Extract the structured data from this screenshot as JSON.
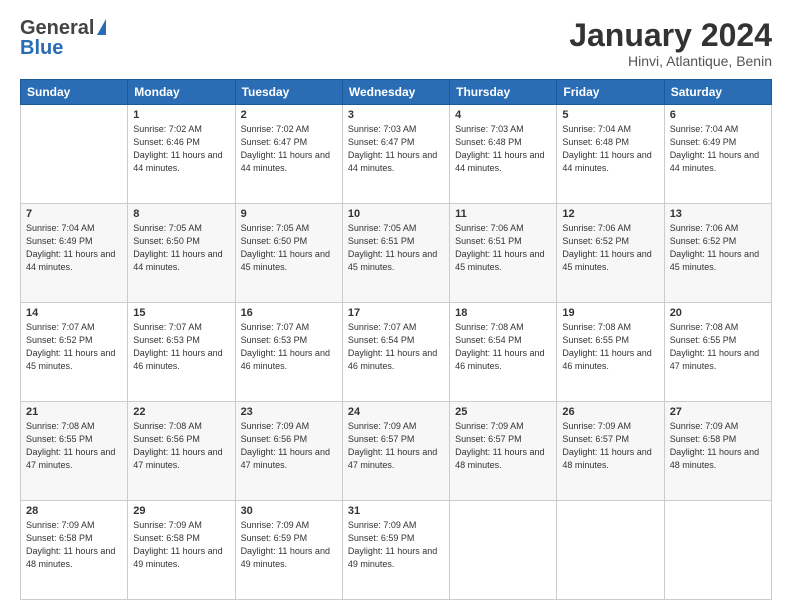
{
  "header": {
    "logo_general": "General",
    "logo_blue": "Blue",
    "title": "January 2024",
    "location": "Hinvi, Atlantique, Benin"
  },
  "days_of_week": [
    "Sunday",
    "Monday",
    "Tuesday",
    "Wednesday",
    "Thursday",
    "Friday",
    "Saturday"
  ],
  "weeks": [
    [
      {
        "day": "",
        "sunrise": "",
        "sunset": "",
        "daylight": ""
      },
      {
        "day": "1",
        "sunrise": "Sunrise: 7:02 AM",
        "sunset": "Sunset: 6:46 PM",
        "daylight": "Daylight: 11 hours and 44 minutes."
      },
      {
        "day": "2",
        "sunrise": "Sunrise: 7:02 AM",
        "sunset": "Sunset: 6:47 PM",
        "daylight": "Daylight: 11 hours and 44 minutes."
      },
      {
        "day": "3",
        "sunrise": "Sunrise: 7:03 AM",
        "sunset": "Sunset: 6:47 PM",
        "daylight": "Daylight: 11 hours and 44 minutes."
      },
      {
        "day": "4",
        "sunrise": "Sunrise: 7:03 AM",
        "sunset": "Sunset: 6:48 PM",
        "daylight": "Daylight: 11 hours and 44 minutes."
      },
      {
        "day": "5",
        "sunrise": "Sunrise: 7:04 AM",
        "sunset": "Sunset: 6:48 PM",
        "daylight": "Daylight: 11 hours and 44 minutes."
      },
      {
        "day": "6",
        "sunrise": "Sunrise: 7:04 AM",
        "sunset": "Sunset: 6:49 PM",
        "daylight": "Daylight: 11 hours and 44 minutes."
      }
    ],
    [
      {
        "day": "7",
        "sunrise": "Sunrise: 7:04 AM",
        "sunset": "Sunset: 6:49 PM",
        "daylight": "Daylight: 11 hours and 44 minutes."
      },
      {
        "day": "8",
        "sunrise": "Sunrise: 7:05 AM",
        "sunset": "Sunset: 6:50 PM",
        "daylight": "Daylight: 11 hours and 44 minutes."
      },
      {
        "day": "9",
        "sunrise": "Sunrise: 7:05 AM",
        "sunset": "Sunset: 6:50 PM",
        "daylight": "Daylight: 11 hours and 45 minutes."
      },
      {
        "day": "10",
        "sunrise": "Sunrise: 7:05 AM",
        "sunset": "Sunset: 6:51 PM",
        "daylight": "Daylight: 11 hours and 45 minutes."
      },
      {
        "day": "11",
        "sunrise": "Sunrise: 7:06 AM",
        "sunset": "Sunset: 6:51 PM",
        "daylight": "Daylight: 11 hours and 45 minutes."
      },
      {
        "day": "12",
        "sunrise": "Sunrise: 7:06 AM",
        "sunset": "Sunset: 6:52 PM",
        "daylight": "Daylight: 11 hours and 45 minutes."
      },
      {
        "day": "13",
        "sunrise": "Sunrise: 7:06 AM",
        "sunset": "Sunset: 6:52 PM",
        "daylight": "Daylight: 11 hours and 45 minutes."
      }
    ],
    [
      {
        "day": "14",
        "sunrise": "Sunrise: 7:07 AM",
        "sunset": "Sunset: 6:52 PM",
        "daylight": "Daylight: 11 hours and 45 minutes."
      },
      {
        "day": "15",
        "sunrise": "Sunrise: 7:07 AM",
        "sunset": "Sunset: 6:53 PM",
        "daylight": "Daylight: 11 hours and 46 minutes."
      },
      {
        "day": "16",
        "sunrise": "Sunrise: 7:07 AM",
        "sunset": "Sunset: 6:53 PM",
        "daylight": "Daylight: 11 hours and 46 minutes."
      },
      {
        "day": "17",
        "sunrise": "Sunrise: 7:07 AM",
        "sunset": "Sunset: 6:54 PM",
        "daylight": "Daylight: 11 hours and 46 minutes."
      },
      {
        "day": "18",
        "sunrise": "Sunrise: 7:08 AM",
        "sunset": "Sunset: 6:54 PM",
        "daylight": "Daylight: 11 hours and 46 minutes."
      },
      {
        "day": "19",
        "sunrise": "Sunrise: 7:08 AM",
        "sunset": "Sunset: 6:55 PM",
        "daylight": "Daylight: 11 hours and 46 minutes."
      },
      {
        "day": "20",
        "sunrise": "Sunrise: 7:08 AM",
        "sunset": "Sunset: 6:55 PM",
        "daylight": "Daylight: 11 hours and 47 minutes."
      }
    ],
    [
      {
        "day": "21",
        "sunrise": "Sunrise: 7:08 AM",
        "sunset": "Sunset: 6:55 PM",
        "daylight": "Daylight: 11 hours and 47 minutes."
      },
      {
        "day": "22",
        "sunrise": "Sunrise: 7:08 AM",
        "sunset": "Sunset: 6:56 PM",
        "daylight": "Daylight: 11 hours and 47 minutes."
      },
      {
        "day": "23",
        "sunrise": "Sunrise: 7:09 AM",
        "sunset": "Sunset: 6:56 PM",
        "daylight": "Daylight: 11 hours and 47 minutes."
      },
      {
        "day": "24",
        "sunrise": "Sunrise: 7:09 AM",
        "sunset": "Sunset: 6:57 PM",
        "daylight": "Daylight: 11 hours and 47 minutes."
      },
      {
        "day": "25",
        "sunrise": "Sunrise: 7:09 AM",
        "sunset": "Sunset: 6:57 PM",
        "daylight": "Daylight: 11 hours and 48 minutes."
      },
      {
        "day": "26",
        "sunrise": "Sunrise: 7:09 AM",
        "sunset": "Sunset: 6:57 PM",
        "daylight": "Daylight: 11 hours and 48 minutes."
      },
      {
        "day": "27",
        "sunrise": "Sunrise: 7:09 AM",
        "sunset": "Sunset: 6:58 PM",
        "daylight": "Daylight: 11 hours and 48 minutes."
      }
    ],
    [
      {
        "day": "28",
        "sunrise": "Sunrise: 7:09 AM",
        "sunset": "Sunset: 6:58 PM",
        "daylight": "Daylight: 11 hours and 48 minutes."
      },
      {
        "day": "29",
        "sunrise": "Sunrise: 7:09 AM",
        "sunset": "Sunset: 6:58 PM",
        "daylight": "Daylight: 11 hours and 49 minutes."
      },
      {
        "day": "30",
        "sunrise": "Sunrise: 7:09 AM",
        "sunset": "Sunset: 6:59 PM",
        "daylight": "Daylight: 11 hours and 49 minutes."
      },
      {
        "day": "31",
        "sunrise": "Sunrise: 7:09 AM",
        "sunset": "Sunset: 6:59 PM",
        "daylight": "Daylight: 11 hours and 49 minutes."
      },
      {
        "day": "",
        "sunrise": "",
        "sunset": "",
        "daylight": ""
      },
      {
        "day": "",
        "sunrise": "",
        "sunset": "",
        "daylight": ""
      },
      {
        "day": "",
        "sunrise": "",
        "sunset": "",
        "daylight": ""
      }
    ]
  ]
}
